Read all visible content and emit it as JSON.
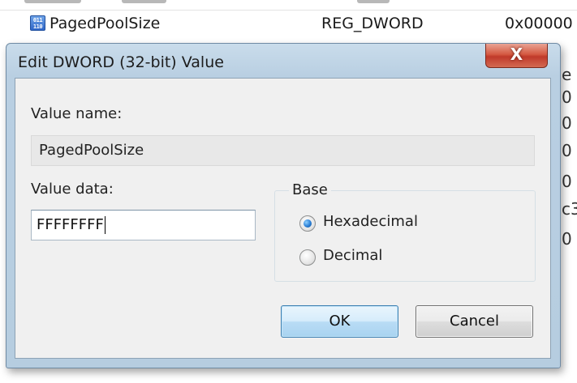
{
  "background_row": {
    "name": "PagedPoolSize",
    "type": "REG_DWORD",
    "data": "0x00000",
    "icon": "registry-binary-icon",
    "icon_glyph": "011\n110"
  },
  "background_peek": [
    "e",
    "0",
    "0",
    "0",
    "0",
    "c3",
    "0"
  ],
  "dialog": {
    "title": "Edit DWORD (32-bit) Value",
    "close_label": "X",
    "value_name_label": "Value name:",
    "value_name": "PagedPoolSize",
    "value_data_label": "Value data:",
    "value_data": "FFFFFFFF",
    "base": {
      "legend": "Base",
      "options": [
        {
          "label": "Hexadecimal",
          "checked": true
        },
        {
          "label": "Decimal",
          "checked": false
        }
      ]
    },
    "ok_label": "OK",
    "cancel_label": "Cancel"
  },
  "colors": {
    "dialog_frame": "#b9cfe2",
    "close_button": "#c0392a",
    "default_button_border": "#3c7fb1"
  }
}
